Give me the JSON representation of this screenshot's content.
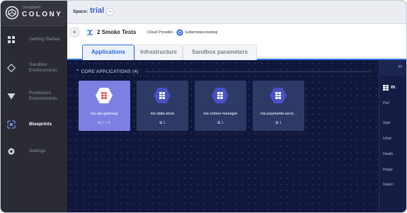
{
  "app": {
    "logo_sub": "CloudShell",
    "logo_main": "COLONY"
  },
  "sidebar": {
    "items": [
      {
        "label": "Getting Started",
        "icon": "grid-icon"
      },
      {
        "label": "Sandbox Environments",
        "icon": "diamond-icon"
      },
      {
        "label": "Production Environments",
        "icon": "triangle-down-icon"
      },
      {
        "label": "Blueprints",
        "icon": "blueprint-icon",
        "active": true
      },
      {
        "label": "Settings",
        "icon": "gear-icon"
      }
    ]
  },
  "header": {
    "space_label": "Space:",
    "space_value": "trial",
    "space_caret": "⌄"
  },
  "blueprint_bar": {
    "back_glyph": "<",
    "name": "2 Smoke Tests",
    "provider_label": "Cloud Provider",
    "provider_value": "kubernetes-testing"
  },
  "tabs": [
    {
      "label": "Applications",
      "active": true
    },
    {
      "label": "Infrastructure"
    },
    {
      "label": "Sandbox parameters"
    }
  ],
  "canvas": {
    "section_title": "⌃ CORE APPLICATIONS (4)",
    "cards": [
      {
        "name": "ms-api-gateway",
        "meta": "⧉ 1 | ⚙",
        "selected": true
      },
      {
        "name": "ms-data-store",
        "meta": "⧉ 1"
      },
      {
        "name": "ms-orders-manager",
        "meta": "⧉ 1"
      },
      {
        "name": "ms-payments-servi...",
        "meta": "⧉ 1"
      }
    ]
  },
  "right_panel": {
    "tab_label": "Pr",
    "title": "m",
    "labels": [
      "Port",
      "Start",
      "Initial",
      "Health",
      "Image",
      "Depen"
    ]
  },
  "colors": {
    "accent": "#2d6bdc",
    "canvas_bg": "#10173b",
    "card_bg": "#2d3a66",
    "card_selected": "#7e7fe3",
    "hex_fill": "#4a51c4"
  }
}
